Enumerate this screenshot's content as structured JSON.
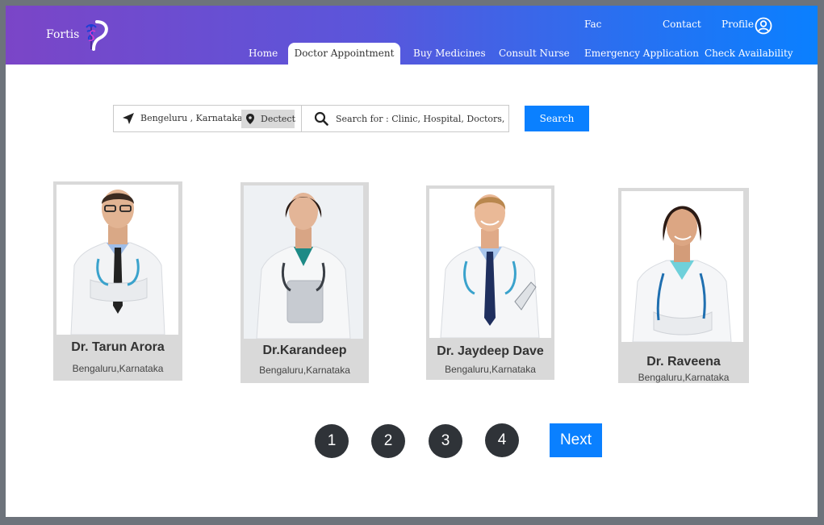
{
  "brand": {
    "name": "Fortis"
  },
  "top_links": {
    "fac": "Fac",
    "contact": "Contact",
    "profile": "Profile"
  },
  "nav": {
    "home": "Home",
    "doctor_appointment": "Doctor Appointment",
    "buy_medicines": "Buy Medicines",
    "consult_nurse": "Consult Nurse",
    "emergency_application": "Emergency Application",
    "check_availability": "Check Availability"
  },
  "search": {
    "location": "Bengeluru , Karnataka",
    "detect_label": "Dectect",
    "placeholder": "Search for : Clinic, Hospital, Doctors, etc.",
    "button_label": "Search"
  },
  "doctors": [
    {
      "name": "Dr. Tarun Arora",
      "location": "Bengaluru,Karnataka"
    },
    {
      "name": "Dr.Karandeep",
      "location": "Bengaluru,Karnataka"
    },
    {
      "name": "Dr. Jaydeep Dave",
      "location": "Bengaluru,Karnataka"
    },
    {
      "name": "Dr. Raveena",
      "location": "Bengaluru,Karnataka"
    }
  ],
  "pagination": {
    "pages": [
      "1",
      "2",
      "3",
      "4"
    ],
    "next_label": "Next"
  },
  "colors": {
    "accent": "#0a80ff",
    "header_start": "#7b45c7",
    "page_dot": "#2f3338"
  }
}
